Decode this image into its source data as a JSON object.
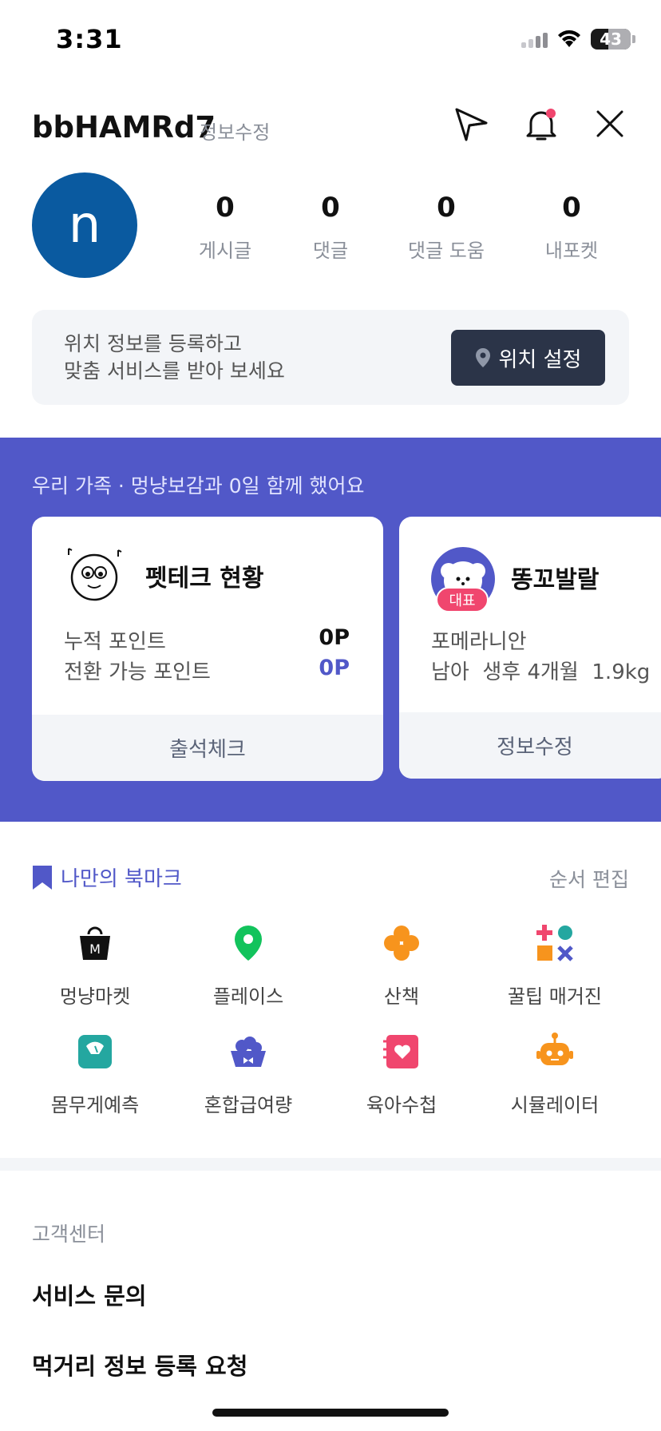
{
  "status_bar": {
    "time": "3:31",
    "battery": "43"
  },
  "header": {
    "username": "bbHAMRd7",
    "edit_label": "정보수정"
  },
  "profile": {
    "avatar_letter": "n",
    "avatar_color": "#0a5aa0"
  },
  "stats": [
    {
      "value": "0",
      "label": "게시글"
    },
    {
      "value": "0",
      "label": "댓글"
    },
    {
      "value": "0",
      "label": "댓글 도움"
    },
    {
      "value": "0",
      "label": "내포켓"
    }
  ],
  "location": {
    "line1": "위치 정보를 등록하고",
    "line2": "맞춤 서비스를 받아 보세요",
    "button": "위치 설정"
  },
  "family": {
    "headline": "우리 가족 · 멍냥보감과 0일 함께 했어요",
    "accent_color": "#5158c8",
    "pettech": {
      "title": "펫테크 현황",
      "row1_label": "누적 포인트",
      "row1_value": "0P",
      "row2_label": "전환 가능 포인트",
      "row2_value": "0P",
      "footer": "출석체크"
    },
    "pet": {
      "name": "똥꼬발랄",
      "badge": "대표",
      "breed": "포메라니안",
      "details": "남아  생후 4개월  1.9kg",
      "footer": "정보수정"
    }
  },
  "bookmarks": {
    "title": "나만의 북마크",
    "edit": "순서 편집",
    "items": [
      {
        "label": "멍냥마켓",
        "icon": "shopping-bag-icon"
      },
      {
        "label": "플레이스",
        "icon": "map-pin-icon"
      },
      {
        "label": "산책",
        "icon": "clover-icon"
      },
      {
        "label": "꿀팁 매거진",
        "icon": "shapes-icon"
      },
      {
        "label": "몸무게예측",
        "icon": "scale-icon"
      },
      {
        "label": "혼합급여량",
        "icon": "food-bowl-icon"
      },
      {
        "label": "육아수첩",
        "icon": "notebook-icon"
      },
      {
        "label": "시뮬레이터",
        "icon": "robot-icon"
      }
    ]
  },
  "customer_center": {
    "title": "고객센터",
    "items": [
      "서비스 문의",
      "먹거리 정보 등록 요청"
    ]
  }
}
